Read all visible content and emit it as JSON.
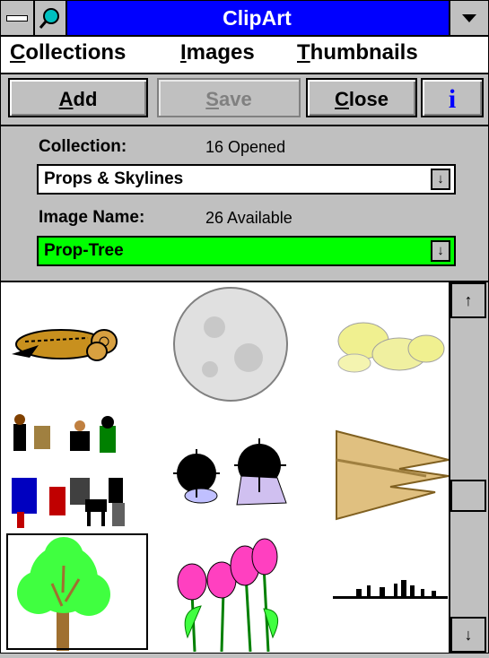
{
  "window": {
    "title": "ClipArt"
  },
  "menu": {
    "items": [
      "Collections",
      "Images",
      "Thumbnails"
    ]
  },
  "toolbar": {
    "add_label": "Add",
    "save_label": "Save",
    "close_label": "Close",
    "info_label": "i"
  },
  "collection": {
    "label": "Collection:",
    "status": "16 Opened",
    "selected": "Props & Skylines"
  },
  "image_name": {
    "label": "Image Name:",
    "status": "26 Available",
    "selected": "Prop-Tree"
  },
  "colors": {
    "titlebar": "#0000ff",
    "highlight": "#00ff00",
    "window": "#c0c0c0"
  },
  "thumbnails": [
    "log-pile",
    "moon",
    "clouds",
    "people-silhouettes",
    "sea-urchins",
    "hedge",
    "tree",
    "tulips",
    "skyline"
  ]
}
